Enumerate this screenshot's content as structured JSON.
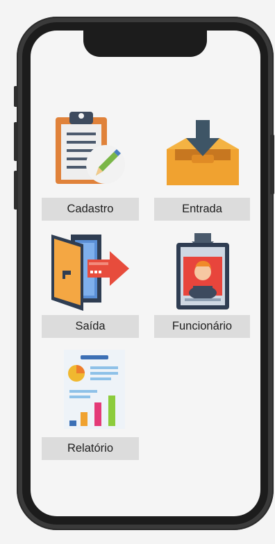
{
  "menu": {
    "items": [
      {
        "label": "Cadastro",
        "icon": "clipboard-edit-icon"
      },
      {
        "label": "Entrada",
        "icon": "inbox-download-icon"
      },
      {
        "label": "Saída",
        "icon": "exit-door-icon"
      },
      {
        "label": "Funcionário",
        "icon": "employee-badge-icon"
      },
      {
        "label": "Relatório",
        "icon": "report-chart-icon"
      }
    ]
  },
  "colors": {
    "label_bg": "#dcdcdc",
    "screen_bg": "#f5f5f5",
    "phone_frame": "#3a3a3a"
  }
}
